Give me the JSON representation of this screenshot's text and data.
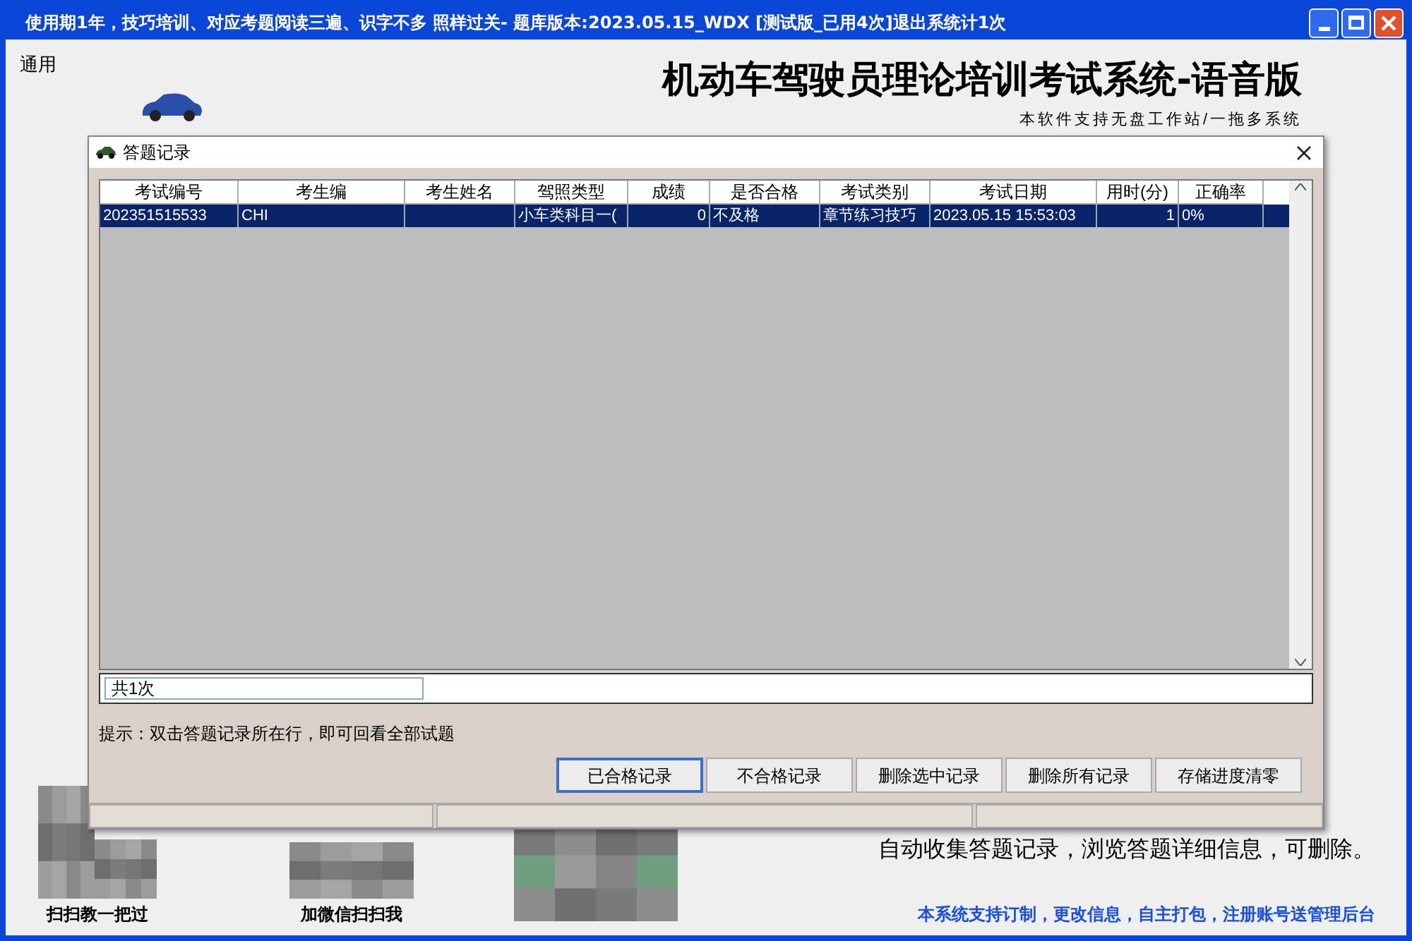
{
  "window": {
    "title": "使用期1年，技巧培训、对应考题阅读三遍、识字不多 照样过关-  题库版本:2023.05.15_WDX [测试版_已用4次]退出系统计1次"
  },
  "menu": [
    "通用"
  ],
  "app_title": "机动车驾驶员理论培训考试系统-语音版",
  "app_subtitle": "本软件支持无盘工作站/一拖多系统",
  "dialog": {
    "title": "答题记录",
    "columns": [
      "考试编号",
      "考生编",
      "考生姓名",
      "驾照类型",
      "成绩",
      "是否合格",
      "考试类别",
      "考试日期",
      "用时(分)",
      "正确率"
    ],
    "rows": [
      {
        "selected": true,
        "cells": [
          "202351515533",
          "CHI",
          "",
          "小车类科目一(",
          "0",
          "不及格",
          "章节练习技巧",
          "2023.05.15 15:53:03",
          "1",
          "0%"
        ]
      }
    ],
    "count": "共1次",
    "hint": "提示：双击答题记录所在行，即可回看全部试题",
    "buttons": [
      {
        "label": "已合格记录",
        "selected": true
      },
      {
        "label": "不合格记录",
        "selected": false
      },
      {
        "label": "删除选中记录",
        "selected": false
      },
      {
        "label": "删除所有记录",
        "selected": false
      },
      {
        "label": "存储进度清零",
        "selected": false
      }
    ]
  },
  "qr_captions": [
    "扫扫教一把过",
    "加微信扫扫我"
  ],
  "feature_text": "自动收集答题记录，浏览答题详细信息，可删除。",
  "footer": "本系统支持订制，更改信息，自主打包，注册账号送管理后台"
}
